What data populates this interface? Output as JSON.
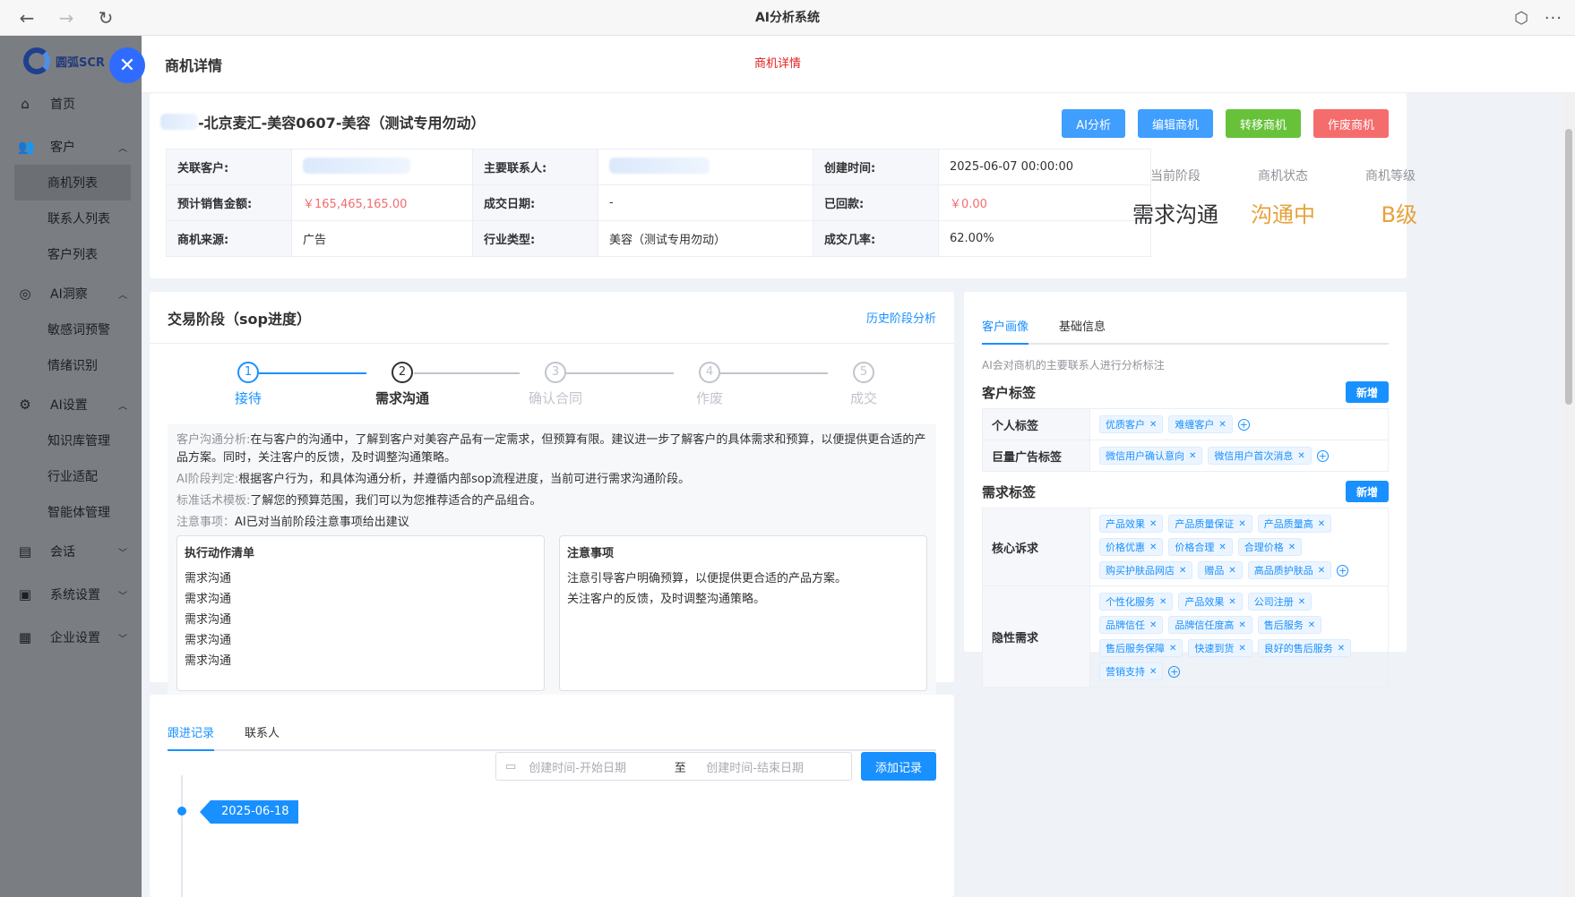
{
  "window": {
    "title": "AI分析系统"
  },
  "sidebar": {
    "logo_text": "圆弧SCR",
    "items": [
      {
        "label": "首页",
        "icon": "home-icon"
      },
      {
        "label": "客户",
        "icon": "users-icon",
        "children": [
          "商机列表",
          "联系人列表",
          "客户列表"
        ]
      },
      {
        "label": "AI洞察",
        "icon": "insight-icon",
        "children": [
          "敏感词预警",
          "情绪识别"
        ]
      },
      {
        "label": "AI设置",
        "icon": "settings-icon",
        "children": [
          "知识库管理",
          "行业适配",
          "智能体管理"
        ]
      },
      {
        "label": "会话",
        "icon": "chat-icon"
      },
      {
        "label": "系统设置",
        "icon": "monitor-icon"
      },
      {
        "label": "企业设置",
        "icon": "building-icon"
      }
    ]
  },
  "drawer": {
    "title": "商机详情",
    "red_label": "商机详情"
  },
  "opportunity": {
    "name_visible": "-北京麦汇-美容0607-美容（测试专用勿动）",
    "buttons": {
      "ai": "AI分析",
      "edit": "编辑商机",
      "transfer": "转移商机",
      "void": "作废商机"
    },
    "info": {
      "customer_label": "关联客户:",
      "contact_label": "主要联系人:",
      "created_label": "创建时间:",
      "created_value": "2025-06-07 00:00:00",
      "amount_label": "预计销售金额:",
      "amount_value": "￥165,465,165.00",
      "deal_date_label": "成交日期:",
      "deal_date_value": "-",
      "returned_label": "已回款:",
      "returned_value": "￥0.00",
      "source_label": "商机来源:",
      "source_value": "广告",
      "industry_label": "行业类型:",
      "industry_value": "美容（测试专用勿动）",
      "rate_label": "成交几率:",
      "rate_value": "62.00%"
    },
    "status": {
      "stage_label": "当前阶段",
      "stage_value": "需求沟通",
      "state_label": "商机状态",
      "state_value": "沟通中",
      "level_label": "商机等级",
      "level_value": "B级"
    }
  },
  "sop": {
    "title": "交易阶段（sop进度）",
    "history_link": "历史阶段分析",
    "steps": [
      {
        "num": "1",
        "label": "接待",
        "state": "done"
      },
      {
        "num": "2",
        "label": "需求沟通",
        "state": "current"
      },
      {
        "num": "3",
        "label": "确认合同",
        "state": "wait"
      },
      {
        "num": "4",
        "label": "作废",
        "state": "wait"
      },
      {
        "num": "5",
        "label": "成交",
        "state": "wait"
      }
    ],
    "analysis_k": "客户沟通分析:",
    "analysis_v": "在与客户的沟通中，了解到客户对美容产品有一定需求，但预算有限。建议进一步了解客户的具体需求和预算，以便提供更合适的产品方案。同时，关注客户的反馈，及时调整沟通策略。",
    "judge_k": "AI阶段判定:",
    "judge_v": "根据客户行为，和具体沟通分析，并遵循内部sop流程进度，当前可进行需求沟通阶段。",
    "script_k": "标准话术模板:",
    "script_v": "了解您的预算范围，我们可以为您推荐适合的产品组合。",
    "note_k": "注意事项：",
    "note_v": "AI已对当前阶段注意事项给出建议",
    "action_title": "执行动作清单",
    "actions": [
      "需求沟通",
      "需求沟通",
      "需求沟通",
      "需求沟通",
      "需求沟通"
    ],
    "notice_title": "注意事项",
    "notices": [
      "注意引导客户明确预算，以便提供更合适的产品方案。",
      "关注客户的反馈，及时调整沟通策略。"
    ]
  },
  "records": {
    "tabs": [
      "跟进记录",
      "联系人"
    ],
    "date_start_placeholder": "创建时间-开始日期",
    "date_sep": "至",
    "date_end_placeholder": "创建时间-结束日期",
    "add_button": "添加记录",
    "timeline_date": "2025-06-18"
  },
  "portrait": {
    "tabs": [
      "客户画像",
      "基础信息"
    ],
    "hint": "AI会对商机的主要联系人进行分析标注",
    "customer_tags_title": "客户标签",
    "demand_tags_title": "需求标签",
    "add_label": "新增",
    "customer_rows": [
      {
        "label": "个人标签",
        "tags": [
          "优质客户",
          "难缠客户"
        ]
      },
      {
        "label": "巨量广告标签",
        "tags": [
          "微信用户确认意向",
          "微信用户首次消息"
        ]
      }
    ],
    "demand_rows": [
      {
        "label": "核心诉求",
        "tags": [
          "产品效果",
          "产品质量保证",
          "产品质量高",
          "价格优惠",
          "价格合理",
          "合理价格",
          "购买护肤品网店",
          "赠品",
          "高品质护肤品"
        ]
      },
      {
        "label": "隐性需求",
        "tags": [
          "个性化服务",
          "产品效果",
          "公司注册",
          "品牌信任",
          "品牌信任度高",
          "售后服务",
          "售后服务保障",
          "快速到货",
          "良好的售后服务",
          "营销支持"
        ]
      }
    ]
  },
  "colors": {
    "primary": "#1890ff",
    "green": "#67c23a",
    "red": "#f56c6c",
    "orange": "#e6a23c"
  }
}
